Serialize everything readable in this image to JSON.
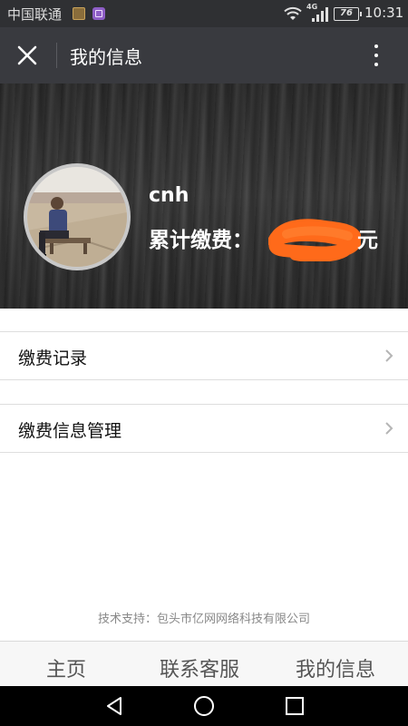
{
  "status_bar": {
    "carrier": "中国联通",
    "network": "4G",
    "battery": "76",
    "time": "10:31"
  },
  "app_bar": {
    "title": "我的信息",
    "close_icon": "close-icon",
    "menu_icon": "more-vertical-icon"
  },
  "profile": {
    "username": "cnh",
    "fee_label": "累计缴费：",
    "fee_unit": "元",
    "fee_value_obscured": true,
    "scribble_color": "#ff6a1a"
  },
  "menu": {
    "items": [
      {
        "label": "缴费记录"
      },
      {
        "label": "缴费信息管理"
      }
    ]
  },
  "footer": {
    "support_text": "技术支持：包头市亿网网络科技有限公司"
  },
  "tabs": [
    {
      "label": "主页"
    },
    {
      "label": "联系客服"
    },
    {
      "label": "我的信息"
    }
  ],
  "colors": {
    "app_bar": "#393a3f",
    "status_bar": "#2f3033",
    "list_border": "#dedede",
    "tab_text": "#555555"
  }
}
